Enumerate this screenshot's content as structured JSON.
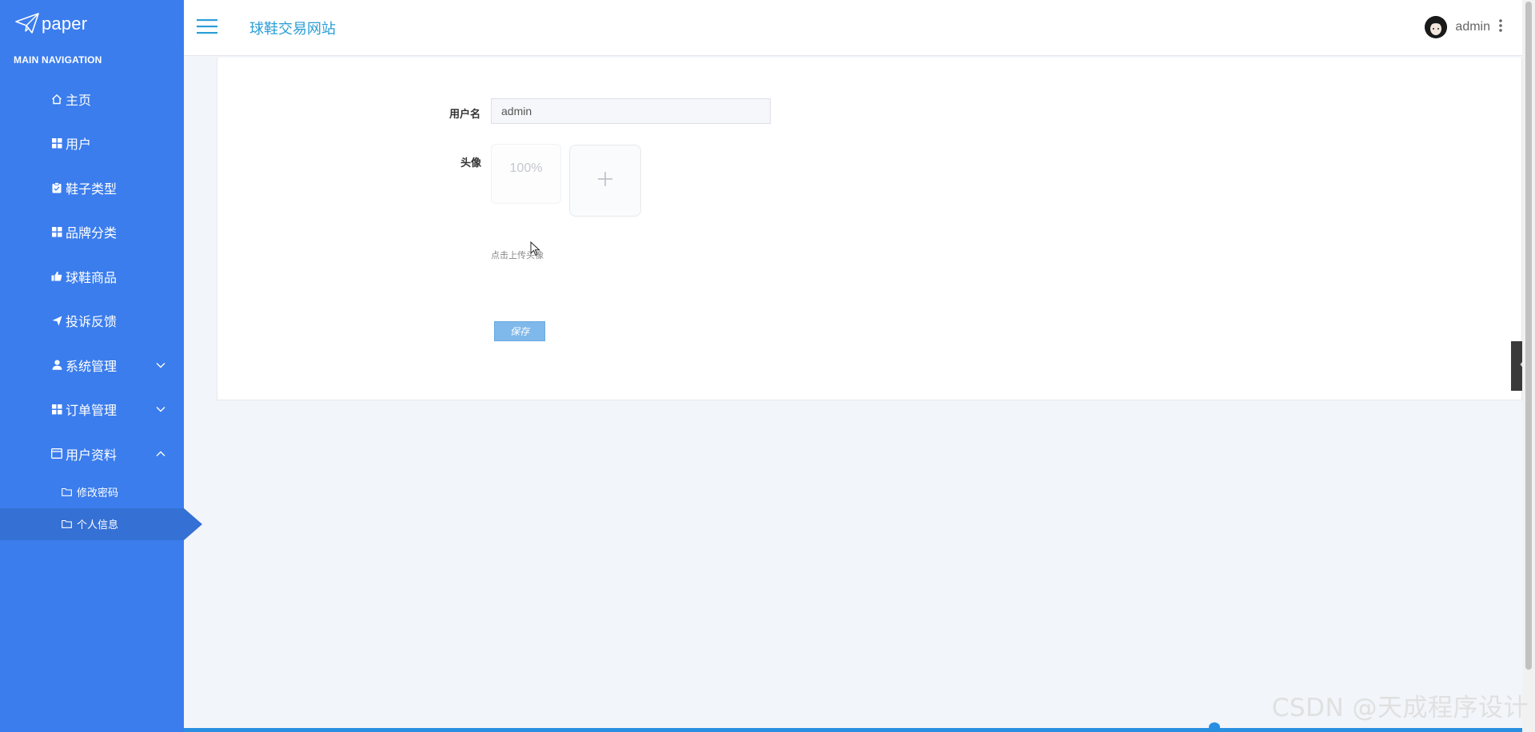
{
  "sidebar": {
    "logo_text": "paper",
    "nav_header": "MAIN NAVIGATION",
    "items": [
      {
        "label": "主页",
        "icon": "home-icon"
      },
      {
        "label": "用户",
        "icon": "grid-icon"
      },
      {
        "label": "鞋子类型",
        "icon": "clipboard-icon"
      },
      {
        "label": "品牌分类",
        "icon": "grid-icon"
      },
      {
        "label": "球鞋商品",
        "icon": "thumbs-up-icon"
      },
      {
        "label": "投诉反馈",
        "icon": "paper-plane-icon"
      },
      {
        "label": "系统管理",
        "icon": "user-icon",
        "expanded": false
      },
      {
        "label": "订单管理",
        "icon": "grid-icon",
        "expanded": false
      },
      {
        "label": "用户资料",
        "icon": "window-icon",
        "expanded": true
      }
    ],
    "sub_items": [
      {
        "label": "修改密码",
        "icon": "folder-icon"
      },
      {
        "label": "个人信息",
        "icon": "folder-icon",
        "active": true
      }
    ]
  },
  "header": {
    "site_title": "球鞋交易网站",
    "username": "admin"
  },
  "form": {
    "username_label": "用户名",
    "username_value": "admin",
    "avatar_label": "头像",
    "upload_progress": "100%",
    "upload_hint": "点击上传头像",
    "save_label": "保存"
  },
  "watermark": "CSDN @天成程序设计",
  "colors": {
    "sidebar_bg": "#3b7ded",
    "active_item": "#3570d4",
    "title": "#2a9ed6",
    "save_button": "#7fb8ea"
  }
}
